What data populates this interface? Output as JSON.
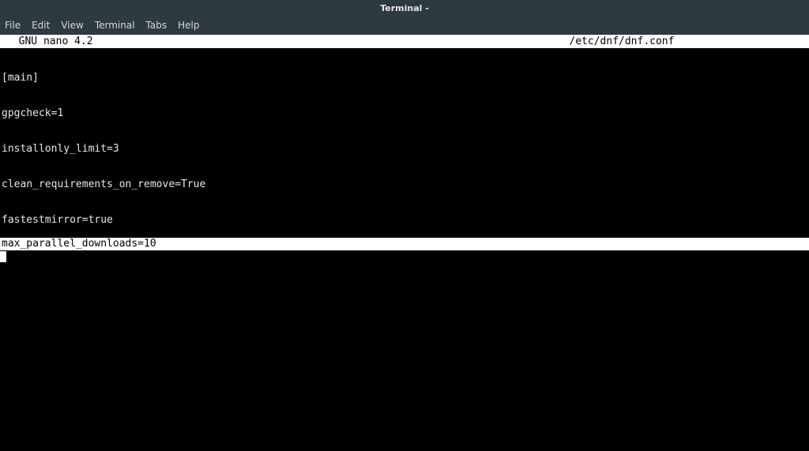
{
  "titlebar": {
    "title": "Terminal -"
  },
  "menubar": {
    "items": [
      "File",
      "Edit",
      "View",
      "Terminal",
      "Tabs",
      "Help"
    ]
  },
  "nano": {
    "header_left": "  GNU nano 4.2",
    "header_right": "/etc/dnf/dnf.conf"
  },
  "file_content": {
    "lines": [
      "[main]",
      "gpgcheck=1",
      "installonly_limit=3",
      "clean_requirements_on_remove=True",
      "fastestmirror=true"
    ],
    "highlighted_line": "max_parallel_downloads=10"
  }
}
